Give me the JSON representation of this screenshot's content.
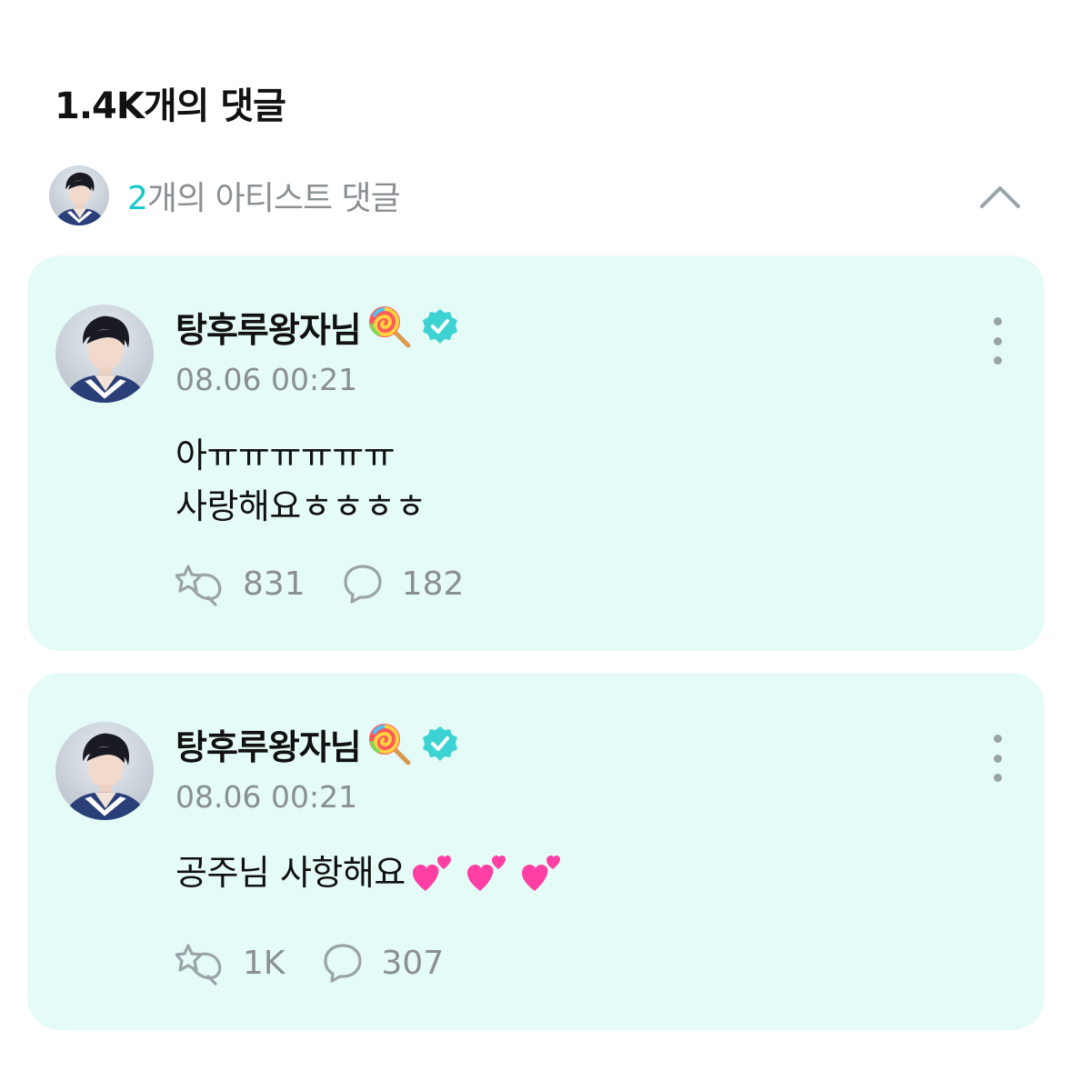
{
  "header": {
    "comment_count_title": "1.4K개의 댓글"
  },
  "artist_section": {
    "count": "2",
    "label": "개의 아티스트 댓글",
    "collapse_icon": "chevron-up-icon"
  },
  "comments": [
    {
      "author": "탕후루왕자님",
      "author_emoji": "lollipop-icon",
      "verified_icon": "verified-badge-icon",
      "timestamp": "08.06 00:21",
      "lines": [
        "아ㅠㅠㅠㅠㅠㅠ",
        "사랑해요ㅎㅎㅎㅎ"
      ],
      "hearts": [],
      "like_icon": "star-hand-icon",
      "likes": "831",
      "reply_icon": "speech-bubble-icon",
      "replies": "182"
    },
    {
      "author": "탕후루왕자님",
      "author_emoji": "lollipop-icon",
      "verified_icon": "verified-badge-icon",
      "timestamp": "08.06 00:21",
      "lines": [
        "공주님 사항해요"
      ],
      "hearts": [
        "two-hearts-icon",
        "two-hearts-icon",
        "two-hearts-icon"
      ],
      "like_icon": "star-hand-icon",
      "likes": "1K",
      "reply_icon": "speech-bubble-icon",
      "replies": "307"
    }
  ],
  "colors": {
    "accent": "#16c8c8",
    "card_bg": "#e5fbf7",
    "muted_text": "#8a8f93",
    "verified": "#3ed3d3",
    "heart": "#ff3fa4"
  }
}
